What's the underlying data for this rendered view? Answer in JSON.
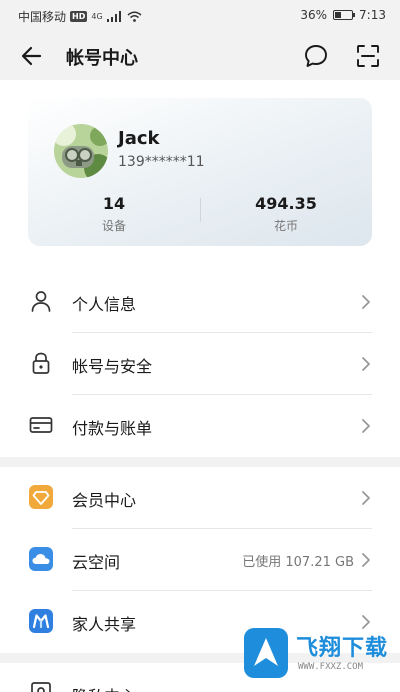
{
  "status_bar": {
    "carrier": "中国移动",
    "hd_badge": "HD",
    "network_badge": "4G",
    "battery": "36%",
    "battery_level": 0.36,
    "time": "7:13"
  },
  "header": {
    "title": "帐号中心"
  },
  "account": {
    "name": "Jack",
    "phone": "139******11",
    "stats": [
      {
        "value": "14",
        "label": "设备"
      },
      {
        "value": "494.35",
        "label": "花币"
      }
    ]
  },
  "menu_groups": [
    [
      {
        "label": "个人信息",
        "icon": "person-icon"
      },
      {
        "label": "帐号与安全",
        "icon": "lock-icon"
      },
      {
        "label": "付款与账单",
        "icon": "card-icon"
      }
    ],
    [
      {
        "label": "会员中心",
        "icon": "member-icon"
      },
      {
        "label": "云空间",
        "icon": "cloud-icon",
        "value": "已使用 107.21 GB"
      },
      {
        "label": "家人共享",
        "icon": "family-icon"
      }
    ],
    [
      {
        "label": "隐私中心",
        "icon": "privacy-icon"
      }
    ]
  ],
  "watermark": {
    "text": "飞翔下载",
    "url": "WWW.FXXZ.COM"
  },
  "colors": {
    "member": "#f0a93a",
    "cloud": "#3a8ee6",
    "family": "#2f7fe0",
    "watermark": "#1d8ddc"
  }
}
